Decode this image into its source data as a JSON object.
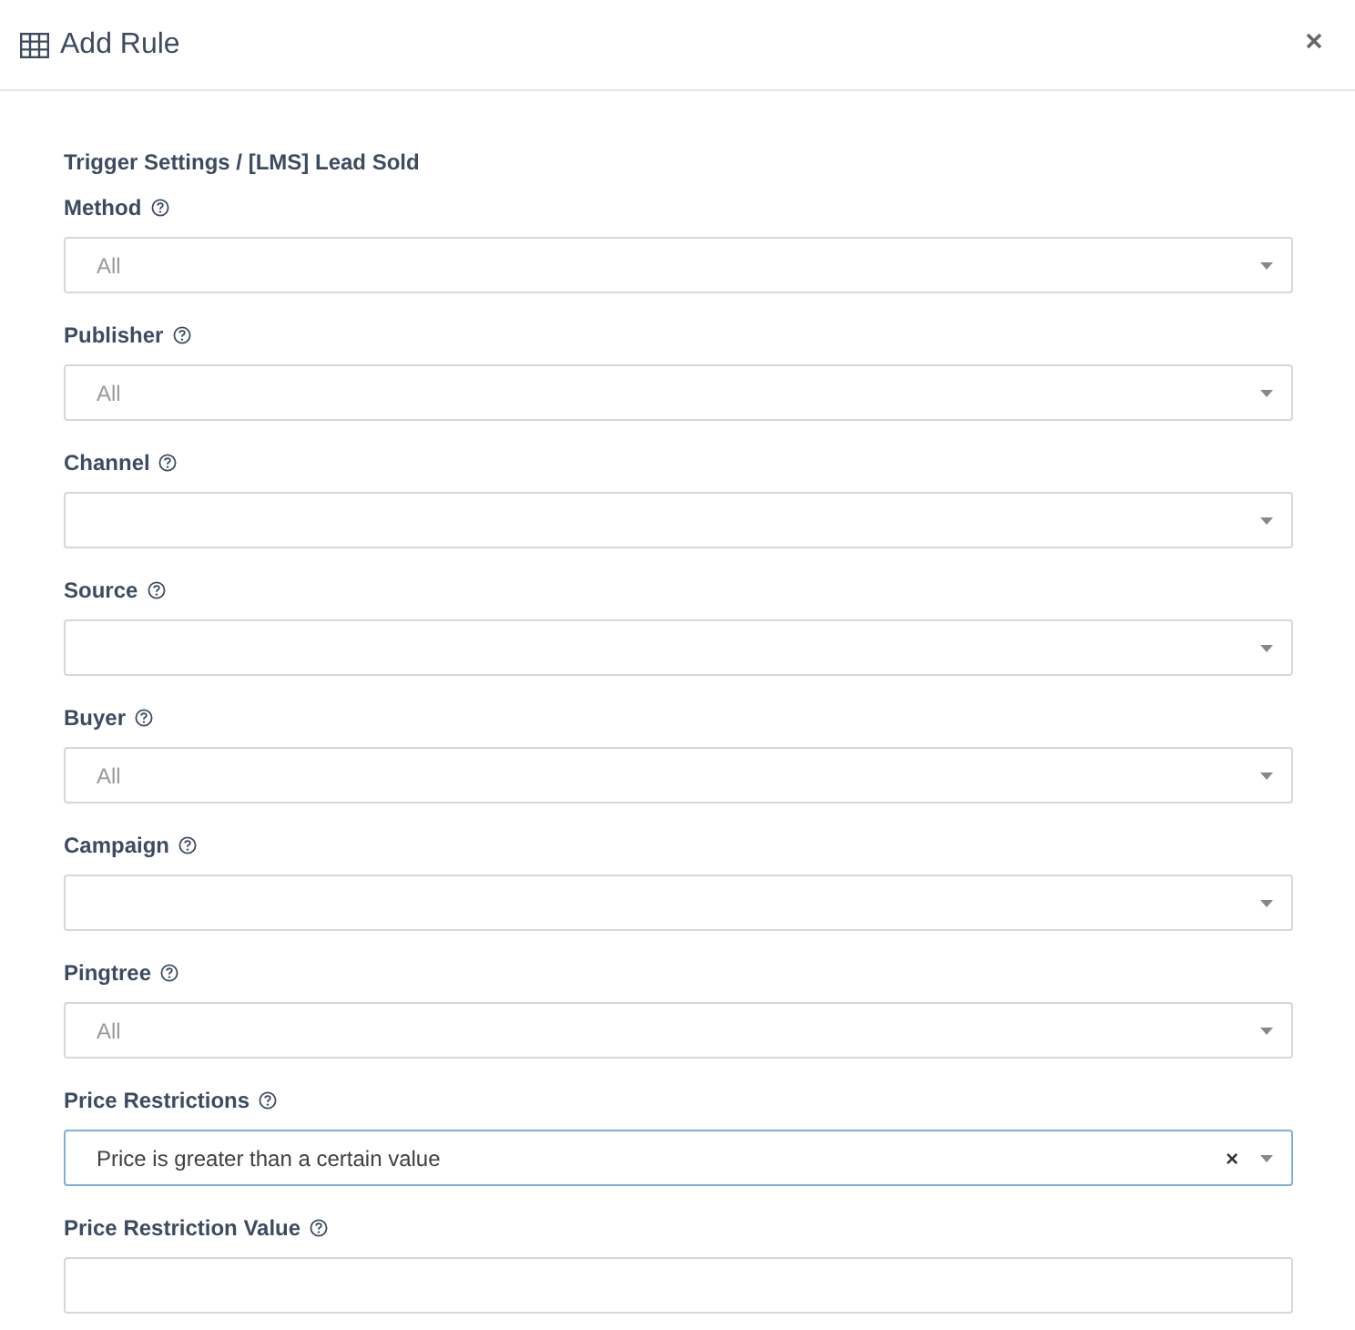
{
  "dialog": {
    "title": "Add Rule"
  },
  "breadcrumb": "Trigger Settings / [LMS] Lead Sold",
  "fields": [
    {
      "kind": "select",
      "label": "Method",
      "placeholder": "All",
      "focused": false
    },
    {
      "kind": "select",
      "label": "Publisher",
      "placeholder": "All",
      "focused": false
    },
    {
      "kind": "select",
      "label": "Channel",
      "focused": false
    },
    {
      "kind": "select",
      "label": "Source",
      "focused": false
    },
    {
      "kind": "select",
      "label": "Buyer",
      "placeholder": "All",
      "focused": false
    },
    {
      "kind": "select",
      "label": "Campaign",
      "focused": false
    },
    {
      "kind": "select",
      "label": "Pingtree",
      "placeholder": "All",
      "focused": false
    },
    {
      "kind": "select",
      "label": "Price Restrictions",
      "value": "Price is greater than a certain value",
      "clear": "×",
      "focused": true
    },
    {
      "kind": "text",
      "label": "Price Restriction Value",
      "focused": false
    }
  ]
}
